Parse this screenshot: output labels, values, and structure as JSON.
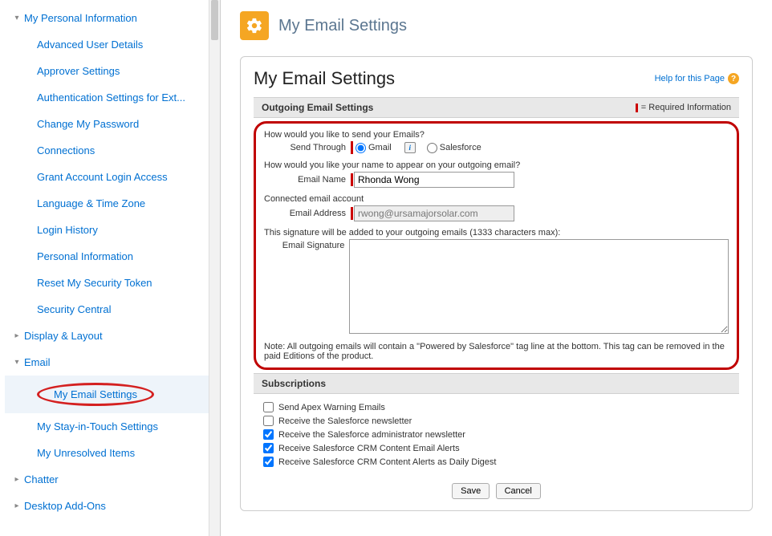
{
  "sidebar": {
    "groups": [
      {
        "label": "My Personal Information",
        "expanded": true,
        "items": [
          "Advanced User Details",
          "Approver Settings",
          "Authentication Settings for Ext...",
          "Change My Password",
          "Connections",
          "Grant Account Login Access",
          "Language & Time Zone",
          "Login History",
          "Personal Information",
          "Reset My Security Token",
          "Security Central"
        ]
      },
      {
        "label": "Display & Layout",
        "expanded": false
      },
      {
        "label": "Email",
        "expanded": true,
        "items": [
          "My Email Settings",
          "My Stay-in-Touch Settings",
          "My Unresolved Items"
        ]
      },
      {
        "label": "Chatter",
        "expanded": false
      },
      {
        "label": "Desktop Add-Ons",
        "expanded": false
      }
    ]
  },
  "header": {
    "title": "My Email Settings"
  },
  "card": {
    "title": "My Email Settings",
    "help_label": "Help for this Page"
  },
  "outgoing": {
    "section_title": "Outgoing Email Settings",
    "required_label": "= Required Information",
    "q_send": "How would you like to send your Emails?",
    "label_send": "Send Through",
    "opt_gmail": "Gmail",
    "opt_sf": "Salesforce",
    "q_name": "How would you like your name to appear on your outgoing email?",
    "label_name": "Email Name",
    "val_name": "Rhonda Wong",
    "q_connected": "Connected email account",
    "label_addr": "Email Address",
    "val_addr": "rwong@ursamajorsolar.com",
    "q_sig": "This signature will be added to your outgoing emails (1333 characters max):",
    "label_sig": "Email Signature",
    "note": "Note: All outgoing emails will contain a \"Powered by Salesforce\" tag line at the bottom. This tag can be removed in the paid Editions of the product."
  },
  "subs": {
    "section_title": "Subscriptions",
    "items": [
      {
        "label": "Send Apex Warning Emails",
        "checked": false
      },
      {
        "label": "Receive the Salesforce newsletter",
        "checked": false
      },
      {
        "label": "Receive the Salesforce administrator newsletter",
        "checked": true
      },
      {
        "label": "Receive Salesforce CRM Content Email Alerts",
        "checked": true
      },
      {
        "label": "Receive Salesforce CRM Content Alerts as Daily Digest",
        "checked": true
      }
    ]
  },
  "buttons": {
    "save": "Save",
    "cancel": "Cancel"
  }
}
